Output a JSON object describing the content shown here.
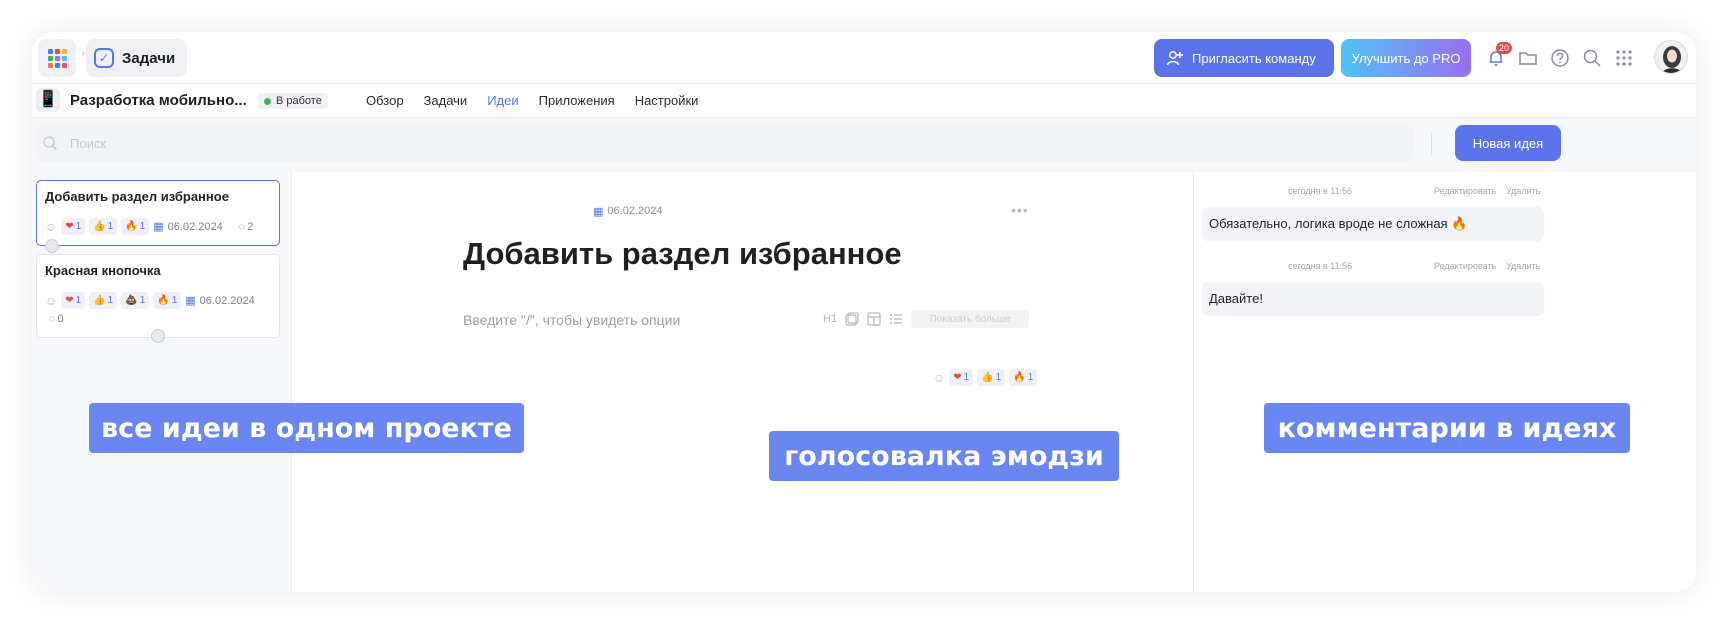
{
  "topbar": {
    "breadcrumb_separator": "›",
    "current_section": "Задачи",
    "invite_label": "Пригласить команду",
    "upgrade_label": "Улучшить до PRO",
    "notifications_count": "20"
  },
  "project": {
    "icon": "📱",
    "title": "Разработка мобильно...",
    "status": "В работе",
    "tabs": [
      {
        "label": "Обзор",
        "active": false
      },
      {
        "label": "Задачи",
        "active": false
      },
      {
        "label": "Идеи",
        "active": true
      },
      {
        "label": "Приложения",
        "active": false
      },
      {
        "label": "Настройки",
        "active": false
      }
    ]
  },
  "search": {
    "placeholder": "Поиск",
    "new_idea_label": "Новая идея"
  },
  "ideas": [
    {
      "title": "Добавить раздел избранное",
      "reactions": [
        {
          "emoji": "❤",
          "count": "1"
        },
        {
          "emoji": "👍",
          "count": "1"
        },
        {
          "emoji": "🔥",
          "count": "1"
        }
      ],
      "date": "06.02.2024",
      "comments": "2"
    },
    {
      "title": "Красная кнопочка",
      "reactions": [
        {
          "emoji": "❤",
          "count": "1"
        },
        {
          "emoji": "👍",
          "count": "1"
        },
        {
          "emoji": "💩",
          "count": "1"
        },
        {
          "emoji": "🔥",
          "count": "1"
        }
      ],
      "date": "06.02.2024",
      "comments": "0"
    }
  ],
  "editor": {
    "date": "06.02.2024",
    "title": "Добавить раздел избранное",
    "placeholder": "Введите \"/\", чтобы увидеть опции",
    "heading_tool": "H1",
    "show_more_label": "Показать больше",
    "reactions": [
      {
        "emoji": "❤",
        "count": "1"
      },
      {
        "emoji": "👍",
        "count": "1"
      },
      {
        "emoji": "🔥",
        "count": "1"
      }
    ]
  },
  "comments": [
    {
      "time": "сегодня в 11:56",
      "edit": "Редактировать",
      "delete": "Удалить",
      "text": "Обязательно, логика вроде не сложная 🔥"
    },
    {
      "time": "сегодня в 11:56",
      "edit": "Редактировать",
      "delete": "Удалить",
      "text": "Давайте!"
    }
  ],
  "callouts": {
    "ideas": "все идеи в одном проекте",
    "voting": "голосовалка эмодзи",
    "comments": "комментарии в идеях"
  },
  "colors": {
    "accent": "#5a73e8",
    "callout": "#6a86f0",
    "status_green": "#3ab35a",
    "badge_red": "#e84a4a"
  }
}
